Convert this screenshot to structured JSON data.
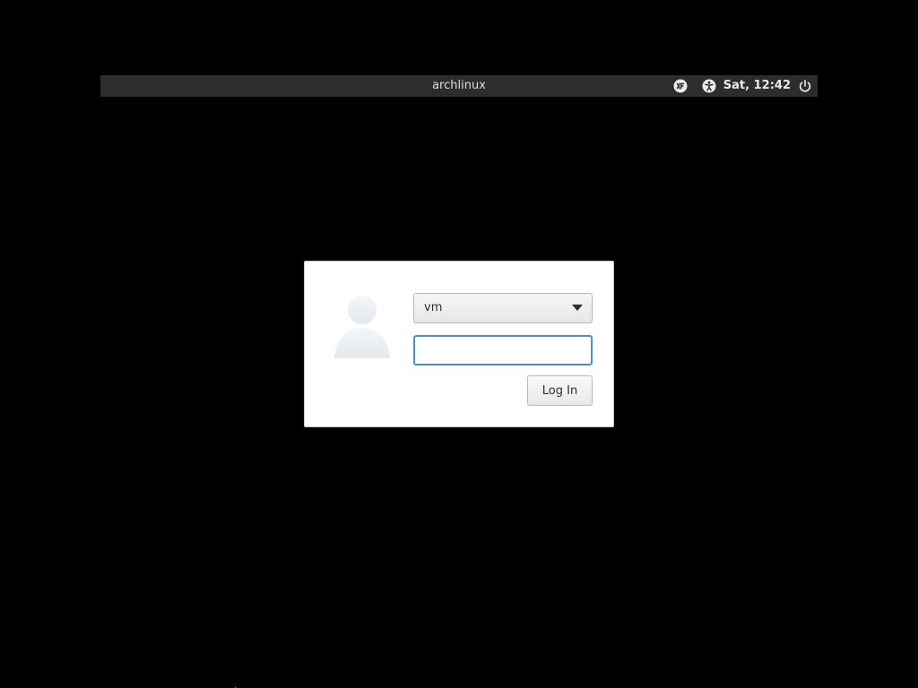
{
  "panel": {
    "hostname": "archlinux",
    "clock": "Sat, 12:42",
    "icons": {
      "keyboard_layout": "keyboard-layout-icon",
      "accessibility": "accessibility-icon",
      "power": "power-icon"
    }
  },
  "login": {
    "avatar_icon": "user-avatar-icon",
    "selected_user": "vm",
    "password_value": "",
    "password_placeholder": "",
    "login_label": "Log In"
  },
  "colors": {
    "background": "#000000",
    "panel": "#2d2d2d",
    "focus_ring": "#4a90d9",
    "dialog": "#ffffff"
  }
}
